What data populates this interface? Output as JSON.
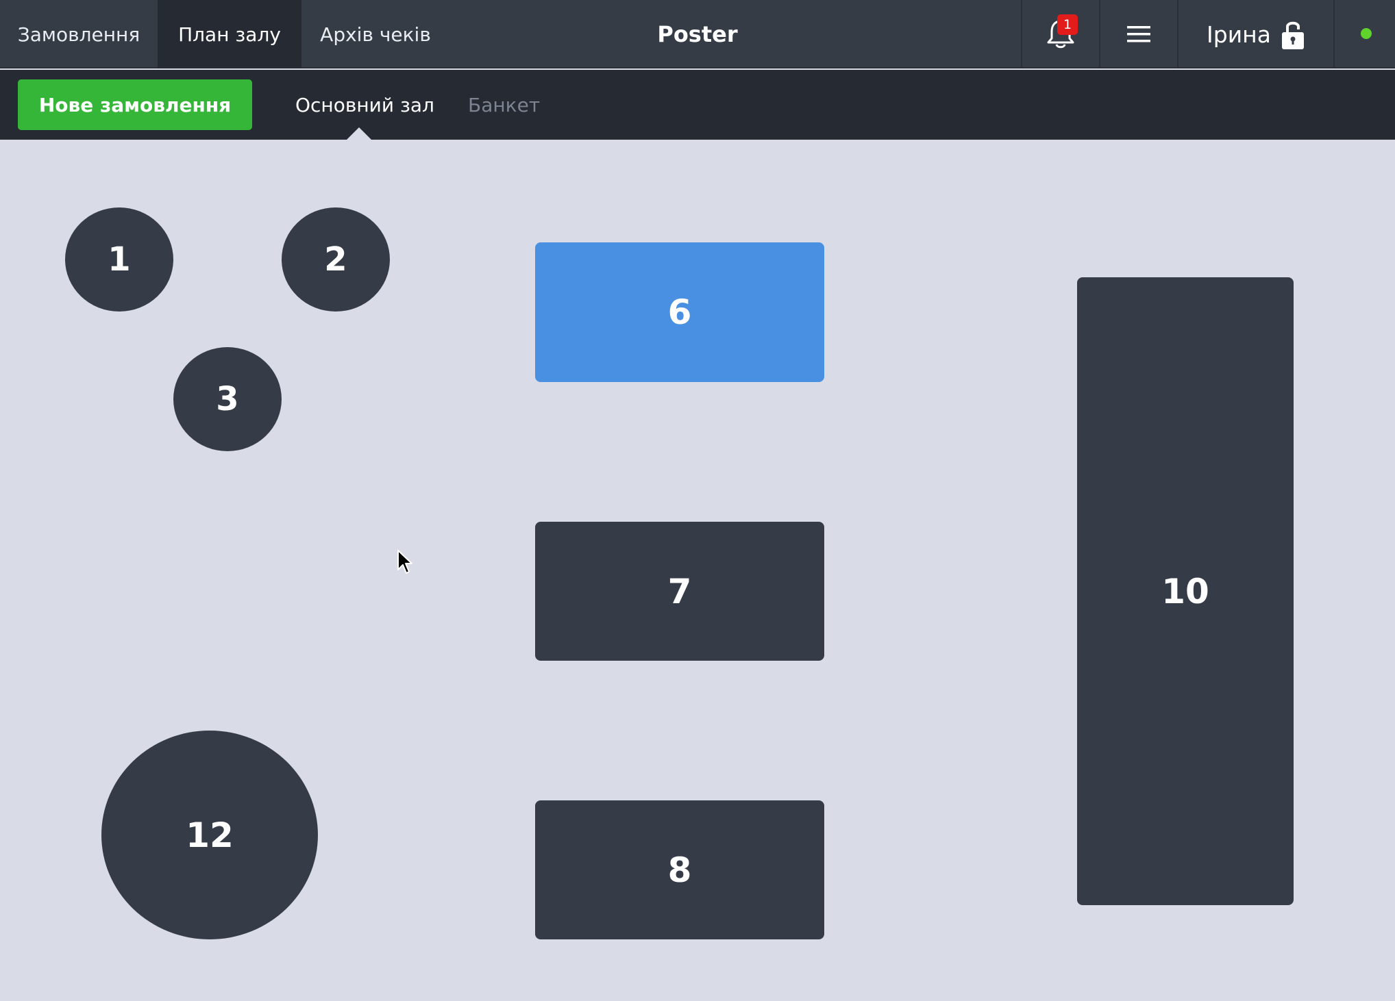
{
  "header": {
    "tabs": [
      {
        "label": "Замовлення",
        "active": false
      },
      {
        "label": "План залу",
        "active": true
      },
      {
        "label": "Архів чеків",
        "active": false
      }
    ],
    "app_title": "Poster",
    "notifications": {
      "icon": "bell-icon",
      "count": "1"
    },
    "menu": {
      "icon": "hamburger-menu-icon"
    },
    "user": {
      "name": "Ірина",
      "icon": "unlocked-padlock-icon"
    },
    "status": {
      "icon": "online-status-dot",
      "color": "#5fd32c"
    }
  },
  "subheader": {
    "new_order_label": "Нове замовлення",
    "halls": [
      {
        "label": "Основний зал",
        "active": true
      },
      {
        "label": "Банкет",
        "active": false
      }
    ]
  },
  "floor_plan": {
    "tables": [
      {
        "number": "1",
        "shape": "round",
        "state": "free"
      },
      {
        "number": "2",
        "shape": "round",
        "state": "free"
      },
      {
        "number": "3",
        "shape": "round",
        "state": "free"
      },
      {
        "number": "6",
        "shape": "rectangle",
        "state": "occupied"
      },
      {
        "number": "7",
        "shape": "rectangle",
        "state": "free"
      },
      {
        "number": "8",
        "shape": "rectangle",
        "state": "free"
      },
      {
        "number": "10",
        "shape": "rectangle",
        "state": "free"
      },
      {
        "number": "12",
        "shape": "round",
        "state": "free"
      }
    ]
  },
  "colors": {
    "topbar": "#363c46",
    "subbar": "#252a33",
    "floor": "#d9dbe7",
    "table_free": "#363c47",
    "table_occupied": "#4a90e2",
    "accent_green": "#35b638",
    "badge_red": "#e21b1b"
  }
}
